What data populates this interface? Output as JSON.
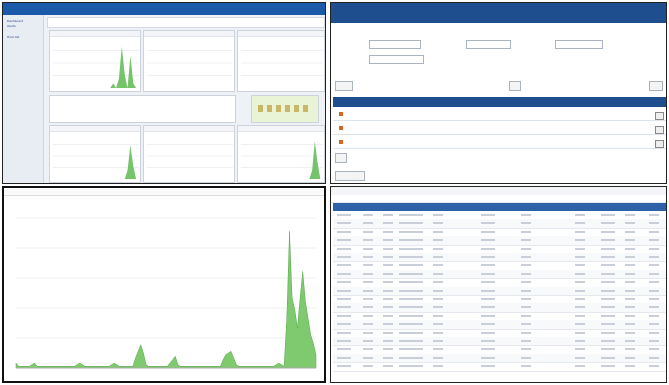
{
  "dashboard": {
    "logo_text": "",
    "sidebar": [
      "Dashboard",
      "Alerts",
      "Host list",
      "",
      "",
      "",
      "",
      ""
    ],
    "series": [
      [
        0,
        0,
        0,
        0,
        0,
        0,
        0,
        0,
        0,
        0,
        0,
        0,
        0,
        0,
        0,
        0,
        0,
        0,
        0,
        0,
        0,
        1,
        0,
        2,
        9,
        3,
        0,
        7,
        1,
        0,
        0
      ],
      [
        0,
        0,
        0,
        0,
        0,
        0,
        0,
        0,
        0,
        0,
        0,
        0,
        0,
        0,
        0,
        0,
        0,
        0,
        0,
        0,
        0,
        0,
        0,
        0,
        0,
        0,
        0,
        0,
        0,
        0,
        0
      ],
      [
        0,
        0,
        0,
        0,
        0,
        0,
        0,
        0,
        0,
        0,
        0,
        0,
        0,
        0,
        0,
        0,
        0,
        0,
        0,
        0,
        0,
        0,
        0,
        0,
        0,
        0,
        0,
        0,
        0,
        0,
        0
      ],
      [
        0,
        0,
        0,
        0,
        0,
        0,
        0,
        0,
        0,
        0,
        0,
        0,
        0,
        0,
        0,
        0,
        0,
        0,
        0,
        0,
        0,
        0,
        0,
        0,
        0,
        0,
        2,
        8,
        3,
        0,
        0
      ],
      [
        0,
        0,
        0,
        0,
        0,
        0,
        0,
        0,
        0,
        0,
        0,
        0,
        0,
        0,
        0,
        0,
        0,
        0,
        0,
        0,
        0,
        0,
        0,
        0,
        0,
        0,
        0,
        0,
        0,
        0,
        0
      ],
      [
        0,
        0,
        0,
        0,
        0,
        0,
        0,
        0,
        0,
        0,
        0,
        0,
        0,
        0,
        0,
        0,
        0,
        0,
        0,
        0,
        0,
        0,
        0,
        0,
        0,
        0,
        2,
        9,
        4,
        0,
        0
      ]
    ],
    "stats": [
      {
        "label": "",
        "value": ""
      },
      {
        "label": "",
        "value": ""
      },
      {
        "label": "",
        "value": ""
      }
    ]
  },
  "query_form": {
    "title": "",
    "filter_label_1": "",
    "filter_label_2": "",
    "filter_label_3": "",
    "select_1": "",
    "select_2": "",
    "buttons": [
      "",
      ""
    ],
    "columns": [
      "",
      "",
      "",
      "",
      ""
    ],
    "rows": [
      [
        "",
        "",
        "",
        ""
      ],
      [
        "",
        "",
        "",
        ""
      ],
      [
        "",
        "",
        "",
        ""
      ]
    ]
  },
  "traffic": {
    "title": "",
    "toolbar": [
      "",
      ""
    ],
    "x_ticks": [
      "",
      "",
      "",
      "",
      "",
      "",
      "",
      "",
      "",
      "",
      "",
      "",
      "",
      "",
      "",
      "",
      "",
      "",
      ""
    ],
    "series": [
      3,
      1,
      1,
      1,
      1,
      1,
      2,
      3,
      1,
      1,
      1,
      1,
      1,
      1,
      1,
      1,
      1,
      1,
      1,
      1,
      1,
      1,
      1,
      2,
      3,
      2,
      1,
      1,
      1,
      1,
      1,
      1,
      1,
      1,
      1,
      1,
      2,
      3,
      2,
      1,
      1,
      1,
      1,
      1,
      1,
      6,
      10,
      14,
      9,
      2,
      1,
      1,
      1,
      1,
      1,
      1,
      1,
      1,
      3,
      5,
      7,
      2,
      1,
      1,
      1,
      1,
      1,
      1,
      1,
      1,
      1,
      1,
      1,
      1,
      1,
      1,
      1,
      1,
      5,
      8,
      9,
      10,
      6,
      2,
      1,
      1,
      1,
      1,
      1,
      1,
      1,
      1,
      1,
      1,
      1,
      1,
      1,
      1,
      2,
      3,
      2,
      1,
      30,
      82,
      42,
      35,
      24,
      42,
      58,
      40,
      30,
      20,
      15,
      8
    ]
  },
  "log_grid": {
    "toolbar": [
      "",
      "",
      "",
      "",
      ""
    ],
    "columns": [
      "",
      "",
      "",
      "",
      "",
      "",
      "",
      "",
      "",
      "",
      "",
      ""
    ],
    "rows_count": 19
  }
}
